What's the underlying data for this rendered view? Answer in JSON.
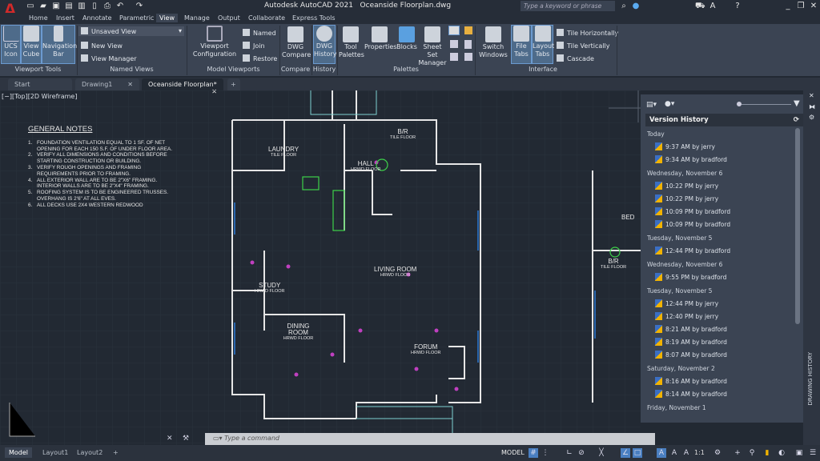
{
  "app": {
    "title": "Autodesk AutoCAD 2021",
    "file": "Oceanside Floorplan.dwg",
    "search_placeholder": "Type a keyword or phrase"
  },
  "ribbon_tabs": [
    "Home",
    "Insert",
    "Annotate",
    "Parametric",
    "View",
    "Manage",
    "Output",
    "Collaborate",
    "Express Tools"
  ],
  "active_tab": "View",
  "ribbon": {
    "viewport_tools": {
      "label": "Viewport Tools",
      "buttons": [
        "UCS Icon",
        "View Cube",
        "Navigation Bar"
      ]
    },
    "named_views": {
      "label": "Named Views",
      "dropdown": "Unsaved View",
      "items": [
        "New View",
        "View Manager"
      ]
    },
    "model_viewports": {
      "label": "Model Viewports",
      "config": "Viewport Configuration",
      "items": [
        "Named",
        "Join",
        "Restore"
      ]
    },
    "compare": {
      "label": "Compare",
      "button": "DWG Compare"
    },
    "history": {
      "label": "History",
      "button": "DWG History"
    },
    "palettes": {
      "label": "Palettes",
      "buttons": [
        "Tool Palettes",
        "Properties",
        "Blocks",
        "Sheet Set Manager"
      ]
    },
    "interface": {
      "label": "Interface",
      "buttons": [
        "Switch Windows",
        "File Tabs",
        "Layout Tabs"
      ],
      "items": [
        "Tile Horizontally",
        "Tile Vertically",
        "Cascade"
      ]
    }
  },
  "doc_tabs": [
    "Start",
    "Drawing1",
    "Oceanside Floorplan*"
  ],
  "viewport_label": "[−][Top][2D Wireframe]",
  "notes": {
    "title": "GENERAL NOTES",
    "items": [
      [
        "1.",
        "FOUNDATION VENTILATION EQUAL TO 1 SF. OF NET",
        "OPENING FOR EACH 150 S.F. OF UNDER FLOOR AREA."
      ],
      [
        "2.",
        "VERIFY ALL DIMENSIONS AND CONDITIONS BEFORE",
        "STARTING CONSTRUCTION OR BUILDING."
      ],
      [
        "3.",
        "VERIFY ROUGH OPENINGS AND FRAMING",
        "REQUIREMENTS PRIOR TO FRAMING."
      ],
      [
        "4.",
        "ALL EXTERIOR WALL ARE TO BE 2\"X6\" FRAMING.",
        "INTERIOR WALLS ARE TO BE 2\"X4\" FRAMING."
      ],
      [
        "5.",
        "ROOFING SYSTEM IS TO BE ENGINEERED TRUSSES.",
        "OVERHANG IS 2'6\" AT ALL EVES."
      ],
      [
        "6.",
        "ALL DECKS USE 2X4 WESTERN REDWOOD",
        ""
      ]
    ]
  },
  "rooms": [
    {
      "name": "LAUNDRY",
      "floor": "TILE FLOOR"
    },
    {
      "name": "B/R",
      "floor": "TILE FLOOR"
    },
    {
      "name": "HALL",
      "floor": "HRWD FLOOR"
    },
    {
      "name": "LIVING ROOM",
      "floor": "HRWD FLOOR"
    },
    {
      "name": "STUDY",
      "floor": "HRWD FLOOR"
    },
    {
      "name": "DINING ROOM",
      "floor": "HRWD FLOOR"
    },
    {
      "name": "FORUM",
      "floor": "HRWD FLOOR"
    },
    {
      "name": "BED",
      "floor": ""
    },
    {
      "name": "B/R",
      "floor": "TILE FLOOR"
    }
  ],
  "version_history": {
    "title": "Version History",
    "groups": [
      {
        "date": "Today",
        "versions": [
          "9:37 AM by jerry",
          "9:34 AM by bradford"
        ]
      },
      {
        "date": "Wednesday, November 6",
        "versions": [
          "10:22 PM by jerry",
          "10:22 PM by jerry",
          "10:09 PM by bradford",
          "10:09 PM by bradford"
        ]
      },
      {
        "date": "Tuesday, November 5",
        "versions": [
          "12:44 PM by bradford"
        ]
      },
      {
        "date": "Wednesday, November 6",
        "versions": [
          "9:55 PM by bradford"
        ]
      },
      {
        "date": "Tuesday, November 5",
        "versions": [
          "12:44 PM by jerry",
          "12:40 PM by jerry",
          "8:21 AM by bradford",
          "8:19 AM by bradford",
          "8:07 AM by bradford"
        ]
      },
      {
        "date": "Saturday, November 2",
        "versions": [
          "8:16 AM by bradford",
          "8:14 AM by bradford"
        ]
      },
      {
        "date": "Friday, November 1",
        "versions": []
      }
    ]
  },
  "side_label": "DRAWING HISTORY",
  "command": {
    "placeholder": "Type a command"
  },
  "layout_tabs": [
    "Model",
    "Layout1",
    "Layout2"
  ],
  "status": {
    "mode": "MODEL",
    "scale": "1:1"
  },
  "colors": {
    "accent": "#4a7fc1",
    "ribbon": "#3b4453",
    "canvas": "#222933",
    "logo": "#d22a2a"
  }
}
